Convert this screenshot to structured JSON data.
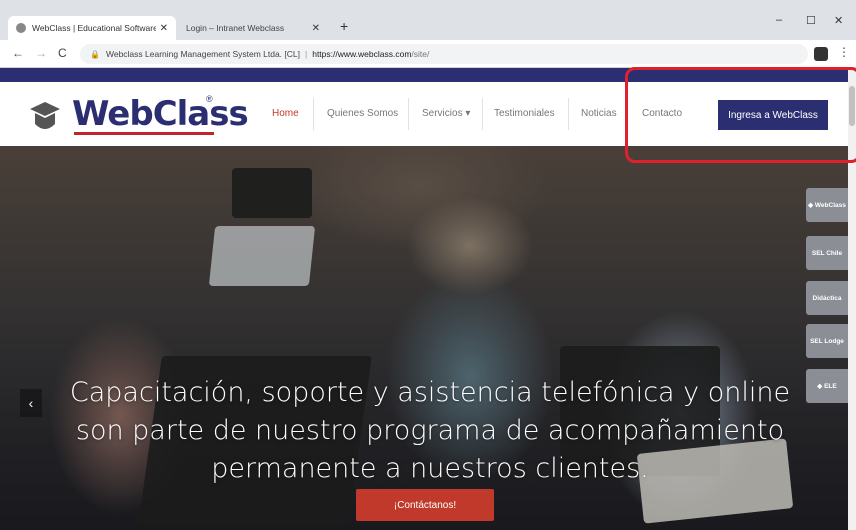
{
  "browser": {
    "tabs": [
      {
        "title": "WebClass | Educational Software",
        "close": "✕"
      },
      {
        "title": "Login – Intranet Webclass",
        "close": "✕"
      }
    ],
    "new_tab": "+",
    "window_controls": {
      "minimize": "–",
      "maximize": "☐",
      "close": "✕"
    },
    "nav": {
      "back": "←",
      "forward": "→",
      "reload": "C"
    },
    "address": {
      "lock": "🔒",
      "site_name": "Webclass Learning Management System Ltda. [CL]",
      "separator": "|",
      "domain": "https://www.webclass.com",
      "path": "/site/"
    },
    "menu": "⋮"
  },
  "site": {
    "logo": {
      "text": "WebClass",
      "reg": "®"
    },
    "menu": [
      {
        "label": "Home"
      },
      {
        "label": "Quienes Somos"
      },
      {
        "label": "Servicios ▾"
      },
      {
        "label": "Testimoniales"
      },
      {
        "label": "Noticias"
      },
      {
        "label": "Contacto"
      }
    ],
    "cta": "Ingresa a WebClass",
    "colors": {
      "brand": "#2b2f72",
      "accent": "#c0392b",
      "highlight": "#e0212d"
    }
  },
  "hero": {
    "line1": "Capacitación, soporte y asistencia telefónica y online",
    "line2": "son parte de nuestro programa de acompañamiento",
    "line3": "permanente a nuestros clientes.",
    "button": "¡Contáctanos!",
    "prev": "‹"
  },
  "side_tabs": [
    {
      "label": "◆ WebClass"
    },
    {
      "label": "SEL Chile"
    },
    {
      "label": "Didáctica"
    },
    {
      "label": "SEL Lodge"
    },
    {
      "label": "◆ ELE"
    }
  ]
}
